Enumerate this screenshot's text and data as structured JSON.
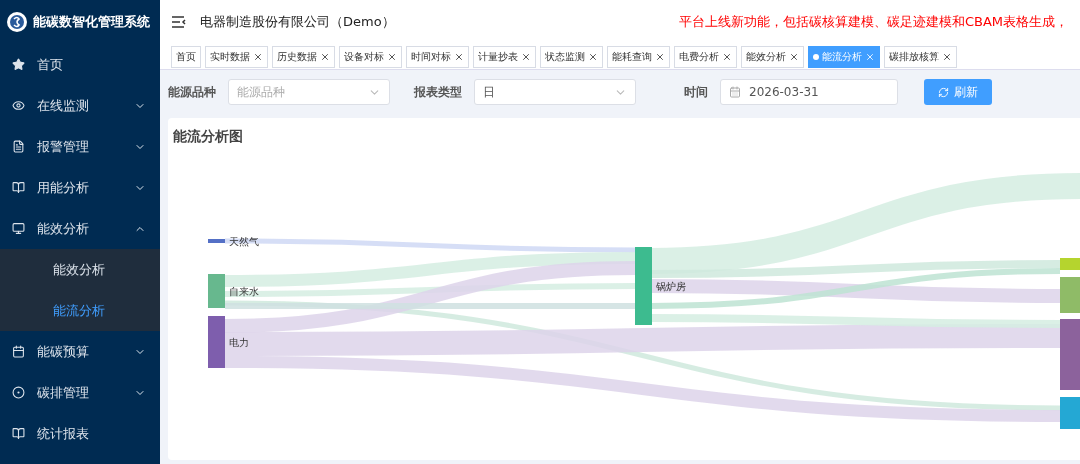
{
  "app": {
    "title": "能碳数智化管理系统"
  },
  "sidebar": {
    "items": [
      {
        "label": "首页"
      },
      {
        "label": "在线监测",
        "expanded": false
      },
      {
        "label": "报警管理",
        "expanded": false
      },
      {
        "label": "用能分析",
        "expanded": false
      },
      {
        "label": "能效分析",
        "expanded": true,
        "children": [
          {
            "label": "能效分析",
            "selected": false
          },
          {
            "label": "能流分析",
            "selected": true
          }
        ]
      },
      {
        "label": "能碳预算",
        "expanded": false
      },
      {
        "label": "碳排管理",
        "expanded": false
      },
      {
        "label": "统计报表"
      }
    ]
  },
  "header": {
    "company": "电器制造股份有限公司（Demo）",
    "notice": "平台上线新功能，包括碳核算建模、碳足迹建模和CBAM表格生成，"
  },
  "tabs": [
    {
      "label": "首页",
      "selected": false,
      "closable": false
    },
    {
      "label": "实时数据",
      "selected": false,
      "closable": true
    },
    {
      "label": "历史数据",
      "selected": false,
      "closable": true
    },
    {
      "label": "设备对标",
      "selected": false,
      "closable": true
    },
    {
      "label": "时间对标",
      "selected": false,
      "closable": true
    },
    {
      "label": "计量抄表",
      "selected": false,
      "closable": true
    },
    {
      "label": "状态监测",
      "selected": false,
      "closable": true
    },
    {
      "label": "能耗查询",
      "selected": false,
      "closable": true
    },
    {
      "label": "电费分析",
      "selected": false,
      "closable": true
    },
    {
      "label": "能效分析",
      "selected": false,
      "closable": true
    },
    {
      "label": "能流分析",
      "selected": true,
      "closable": true
    },
    {
      "label": "碳排放核算",
      "selected": false,
      "closable": true
    }
  ],
  "filters": [
    {
      "kind": "select",
      "label": "能源品种",
      "placeholder": "能源品种"
    },
    {
      "kind": "select",
      "label": "报表类型",
      "value": "日"
    },
    {
      "kind": "date",
      "label": "时间",
      "value": "2026-03-31"
    }
  ],
  "refresh_button": "刷新",
  "chart": {
    "title": "能流分析图",
    "nodes": [
      {
        "label": "天然气",
        "color": "#5470c6"
      },
      {
        "label": "自来水",
        "color": "#67b88e"
      },
      {
        "label": "电力",
        "color": "#7e5ead"
      },
      {
        "label": "锅炉房",
        "color": "#3dbb8f"
      },
      {
        "color": "#b5d42e"
      },
      {
        "color": "#8fbb67"
      },
      {
        "color": "#8c629c"
      },
      {
        "color": "#24a8d4"
      }
    ]
  }
}
